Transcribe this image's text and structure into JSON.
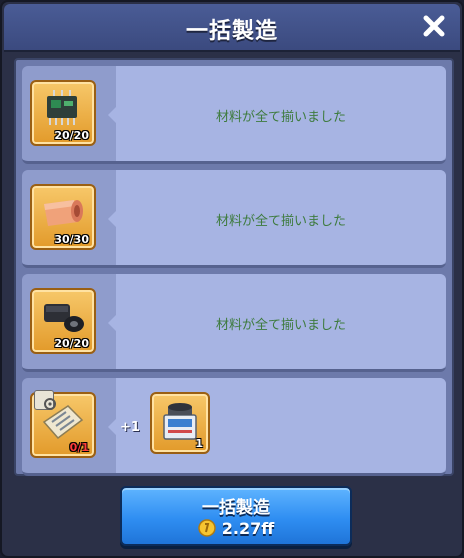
{
  "header": {
    "title": "一括製造",
    "close_icon": "close-icon"
  },
  "rows": [
    {
      "item_icon": "circuit-board-icon",
      "count": "20/20",
      "status": "材料が全て揃いました"
    },
    {
      "item_icon": "copper-roll-icon",
      "count": "30/30",
      "status": "材料が全て揃いました"
    },
    {
      "item_icon": "rubber-part-icon",
      "count": "20/20",
      "status": "材料が全て揃いました"
    },
    {
      "item_icon": "blueprint-icon",
      "count": "0/1",
      "count_color": "#ff3b3b",
      "badge_icon": "gear-icon",
      "plus_text": "+1",
      "output_icon": "machine-icon",
      "output_count": "1"
    }
  ],
  "footer": {
    "button_label": "一括製造",
    "cost": "2.27ff",
    "coin_icon": "coin-icon"
  },
  "colors": {
    "status_green": "#3e7b3e",
    "button_blue": "#2f8ef2",
    "slot_orange": "#e29a2a"
  }
}
